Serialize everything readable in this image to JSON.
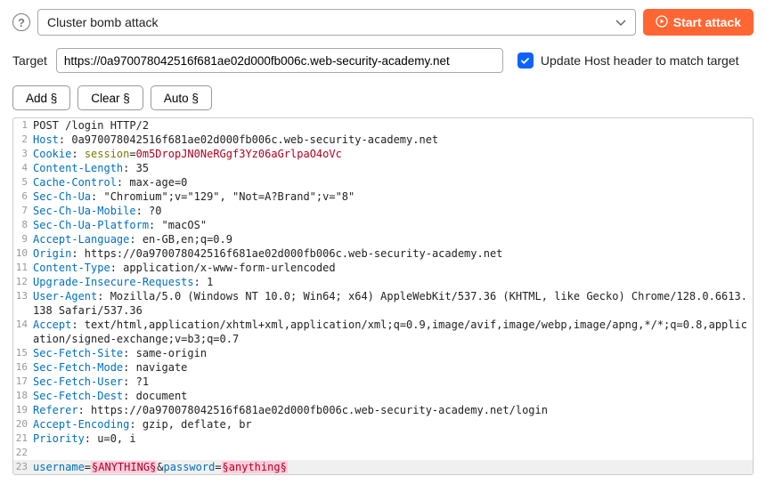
{
  "toolbar": {
    "attack_type": "Cluster bomb attack",
    "start_label": "Start attack"
  },
  "target": {
    "label": "Target",
    "value": "https://0a970078042516f681ae02d000fb006c.web-security-academy.net",
    "update_host_label": "Update Host header to match target",
    "update_host_checked": true
  },
  "buttons": {
    "add": "Add §",
    "clear": "Clear §",
    "auto": "Auto §"
  },
  "request": {
    "first_line": "POST /login HTTP/2",
    "headers": [
      {
        "name": "Host",
        "value": "0a970078042516f681ae02d000fb006c.web-security-academy.net"
      },
      {
        "name": "Content-Length",
        "value": "35"
      },
      {
        "name": "Cache-Control",
        "value": "max-age=0"
      },
      {
        "name": "Sec-Ch-Ua",
        "value": "\"Chromium\";v=\"129\", \"Not=A?Brand\";v=\"8\""
      },
      {
        "name": "Sec-Ch-Ua-Mobile",
        "value": "?0"
      },
      {
        "name": "Sec-Ch-Ua-Platform",
        "value": "\"macOS\""
      },
      {
        "name": "Accept-Language",
        "value": "en-GB,en;q=0.9"
      },
      {
        "name": "Origin",
        "value": "https://0a970078042516f681ae02d000fb006c.web-security-academy.net"
      },
      {
        "name": "Content-Type",
        "value": "application/x-www-form-urlencoded"
      },
      {
        "name": "Upgrade-Insecure-Requests",
        "value": "1"
      },
      {
        "name": "User-Agent",
        "value": "Mozilla/5.0 (Windows NT 10.0; Win64; x64) AppleWebKit/537.36 (KHTML, like Gecko) Chrome/128.0.6613.138 Safari/537.36"
      },
      {
        "name": "Accept",
        "value": "text/html,application/xhtml+xml,application/xml;q=0.9,image/avif,image/webp,image/apng,*/*;q=0.8,application/signed-exchange;v=b3;q=0.7"
      },
      {
        "name": "Sec-Fetch-Site",
        "value": "same-origin"
      },
      {
        "name": "Sec-Fetch-Mode",
        "value": "navigate"
      },
      {
        "name": "Sec-Fetch-User",
        "value": "?1"
      },
      {
        "name": "Sec-Fetch-Dest",
        "value": "document"
      },
      {
        "name": "Referer",
        "value": "https://0a970078042516f681ae02d000fb006c.web-security-academy.net/login"
      },
      {
        "name": "Accept-Encoding",
        "value": "gzip, deflate, br"
      },
      {
        "name": "Priority",
        "value": "u=0, i"
      }
    ],
    "cookie": {
      "name": "Cookie",
      "key": "session",
      "value": "0m5DropJN0NeRGgf3Yz06aGrlpaO4oVc"
    },
    "body": {
      "params": [
        {
          "key": "username",
          "marker": "§ANYTHING§"
        },
        {
          "key": "password",
          "marker": "§anything§"
        }
      ]
    }
  }
}
